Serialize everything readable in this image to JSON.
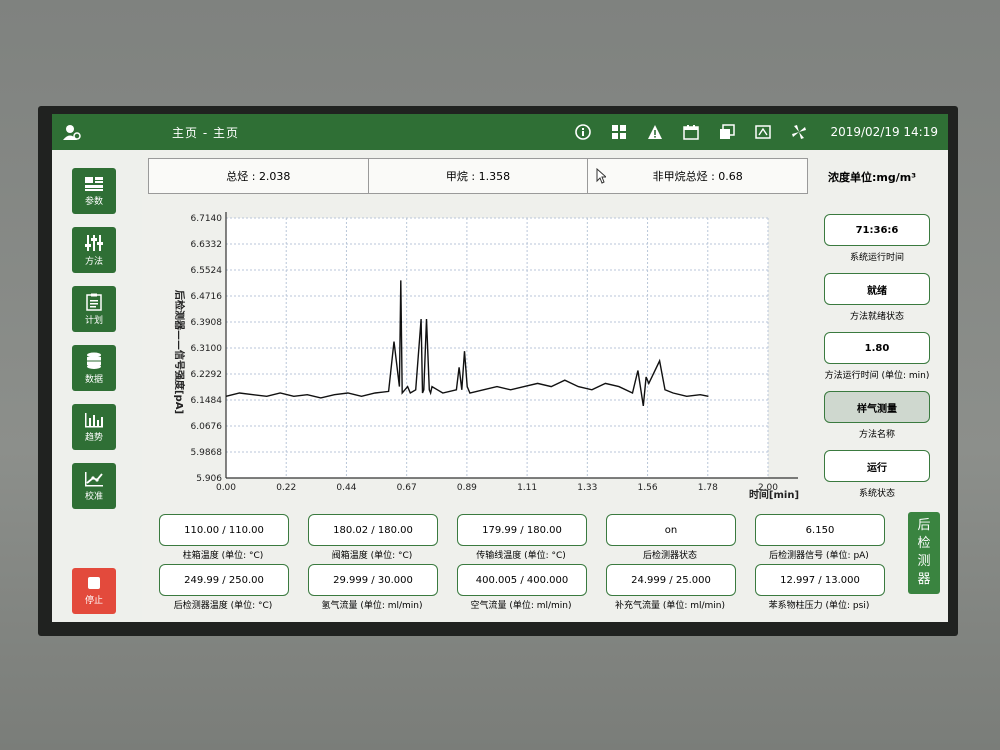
{
  "topbar": {
    "title": "主页 - 主页",
    "datetime": "2019/02/19 14:19",
    "icons": [
      "info-icon",
      "grid-icon",
      "warning-icon",
      "calendar-icon",
      "window-icon",
      "keyboard-icon",
      "fan-icon"
    ]
  },
  "sidebar": {
    "items": [
      {
        "label": "参数",
        "icon": "parameters-icon"
      },
      {
        "label": "方法",
        "icon": "sliders-icon"
      },
      {
        "label": "计划",
        "icon": "clipboard-icon"
      },
      {
        "label": "数据",
        "icon": "database-icon"
      },
      {
        "label": "趋势",
        "icon": "bar-chart-icon"
      },
      {
        "label": "校准",
        "icon": "calibration-icon"
      }
    ],
    "stop_label": "停止"
  },
  "metrics": {
    "total_label": "总烃",
    "total_value": "2.038",
    "methane_label": "甲烷",
    "methane_value": "1.358",
    "nmhc_label": "非甲烷总烃",
    "nmhc_value": "0.68"
  },
  "unit_label": "浓度单位:mg/m³",
  "side_status": [
    {
      "value": "71:36:6",
      "caption": "系统运行时间",
      "shaded": false
    },
    {
      "value": "就绪",
      "caption": "方法就绪状态",
      "shaded": false
    },
    {
      "value": "1.80",
      "caption": "方法运行时间 (单位: min)",
      "shaded": false
    },
    {
      "value": "样气测量",
      "caption": "方法名称",
      "shaded": true
    },
    {
      "value": "运行",
      "caption": "系统状态",
      "shaded": false
    }
  ],
  "readouts": [
    {
      "value": "110.00  /  110.00",
      "caption": "柱箱温度 (单位: °C)"
    },
    {
      "value": "180.02  /  180.00",
      "caption": "阀箱温度 (单位: °C)"
    },
    {
      "value": "179.99  /  180.00",
      "caption": "传输线温度 (单位: °C)"
    },
    {
      "value": "on",
      "caption": "后检测器状态"
    },
    {
      "value": "6.150",
      "caption": "后检测器信号 (单位: pA)"
    },
    {
      "value": "249.99  /  250.00",
      "caption": "后检测器温度 (单位: °C)"
    },
    {
      "value": "29.999  /  30.000",
      "caption": "氢气流量 (单位: ml/min)"
    },
    {
      "value": "400.005  /  400.000",
      "caption": "空气流量 (单位: ml/min)"
    },
    {
      "value": "24.999  /  25.000",
      "caption": "补充气流量 (单位: ml/min)"
    },
    {
      "value": "12.997  /  13.000",
      "caption": "苯系物柱压力 (单位: psi)"
    }
  ],
  "after_detector_button": "后检测器",
  "chart_data": {
    "type": "line",
    "ylabel": "后检测器——信号强度[pA]",
    "xlabel": "时间[min]",
    "yticks": [
      "5.906",
      "5.9868",
      "6.0676",
      "6.1484",
      "6.2292",
      "6.3100",
      "6.3908",
      "6.4716",
      "6.5524",
      "6.6332",
      "6.7140"
    ],
    "xticks": [
      "0.00",
      "0.22",
      "0.44",
      "0.67",
      "0.89",
      "1.11",
      "1.33",
      "1.56",
      "1.78",
      "2.00"
    ],
    "xlim": [
      0,
      2.0
    ],
    "ylim": [
      5.906,
      6.714
    ],
    "grid": true,
    "series": [
      {
        "x": [
          0,
          0.05,
          0.1,
          0.15,
          0.2,
          0.25,
          0.3,
          0.35,
          0.4,
          0.45,
          0.5,
          0.55,
          0.6,
          0.62,
          0.64,
          0.645,
          0.65,
          0.66,
          0.67,
          0.68,
          0.7,
          0.72,
          0.725,
          0.73,
          0.74,
          0.75,
          0.755,
          0.76,
          0.78,
          0.8,
          0.85,
          0.86,
          0.87,
          0.88,
          0.89,
          0.9,
          0.95,
          1.0,
          1.05,
          1.1,
          1.15,
          1.2,
          1.25,
          1.3,
          1.35,
          1.4,
          1.45,
          1.5,
          1.52,
          1.54,
          1.55,
          1.56,
          1.6,
          1.62,
          1.65,
          1.7,
          1.75,
          1.78
        ],
        "y": [
          6.16,
          6.17,
          6.165,
          6.16,
          6.17,
          6.16,
          6.165,
          6.155,
          6.165,
          6.17,
          6.16,
          6.17,
          6.175,
          6.33,
          6.19,
          6.52,
          6.17,
          6.18,
          6.19,
          6.17,
          6.18,
          6.4,
          6.17,
          6.18,
          6.4,
          6.18,
          6.17,
          6.19,
          6.18,
          6.17,
          6.18,
          6.25,
          6.18,
          6.3,
          6.19,
          6.17,
          6.18,
          6.19,
          6.18,
          6.19,
          6.2,
          6.19,
          6.21,
          6.19,
          6.18,
          6.2,
          6.19,
          6.17,
          6.24,
          6.13,
          6.22,
          6.2,
          6.27,
          6.18,
          6.17,
          6.16,
          6.165,
          6.16
        ]
      }
    ]
  }
}
